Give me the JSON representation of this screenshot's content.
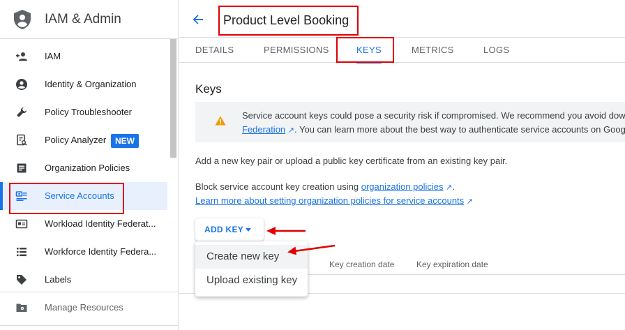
{
  "sidebar": {
    "app_title": "IAM & Admin",
    "items": [
      {
        "label": "IAM",
        "icon": "person-add-icon"
      },
      {
        "label": "Identity & Organization",
        "icon": "account-circle-icon"
      },
      {
        "label": "Policy Troubleshooter",
        "icon": "wrench-icon"
      },
      {
        "label": "Policy Analyzer",
        "icon": "receipt-search-icon"
      },
      {
        "label": "Organization Policies",
        "icon": "document-icon"
      },
      {
        "label": "Service Accounts",
        "icon": "service-account-icon"
      },
      {
        "label": "Workload Identity Federat...",
        "icon": "id-card-icon"
      },
      {
        "label": "Workforce Identity Federa...",
        "icon": "list-icon"
      },
      {
        "label": "Labels",
        "icon": "label-tag-icon"
      }
    ],
    "new_badge": "NEW",
    "manage": "Manage Resources"
  },
  "header": {
    "title": "Product Level Booking"
  },
  "tabs": [
    {
      "label": "DETAILS"
    },
    {
      "label": "PERMISSIONS"
    },
    {
      "label": "KEYS"
    },
    {
      "label": "METRICS"
    },
    {
      "label": "LOGS"
    }
  ],
  "main": {
    "heading": "Keys",
    "warning": {
      "line1": "Service account keys could pose a security risk if compromised. We recommend you avoid dow",
      "link": "Federation",
      "line2_rest": ". You can learn more about the best way to authenticate service accounts on Goog"
    },
    "intro": "Add a new key pair or upload a public key certificate from an existing key pair.",
    "block_prefix": "Block service account key creation using ",
    "block_link": "organization policies",
    "block_suffix": ".",
    "learn_link": "Learn more about setting organization policies for service accounts",
    "add_key": "ADD KEY",
    "columns": [
      "Key creation date",
      "Key expiration date"
    ],
    "menu": [
      "Create new key",
      "Upload existing key"
    ]
  },
  "colors": {
    "accent": "#1a73e8",
    "annotation": "#e00000",
    "warning": "#f29900"
  }
}
